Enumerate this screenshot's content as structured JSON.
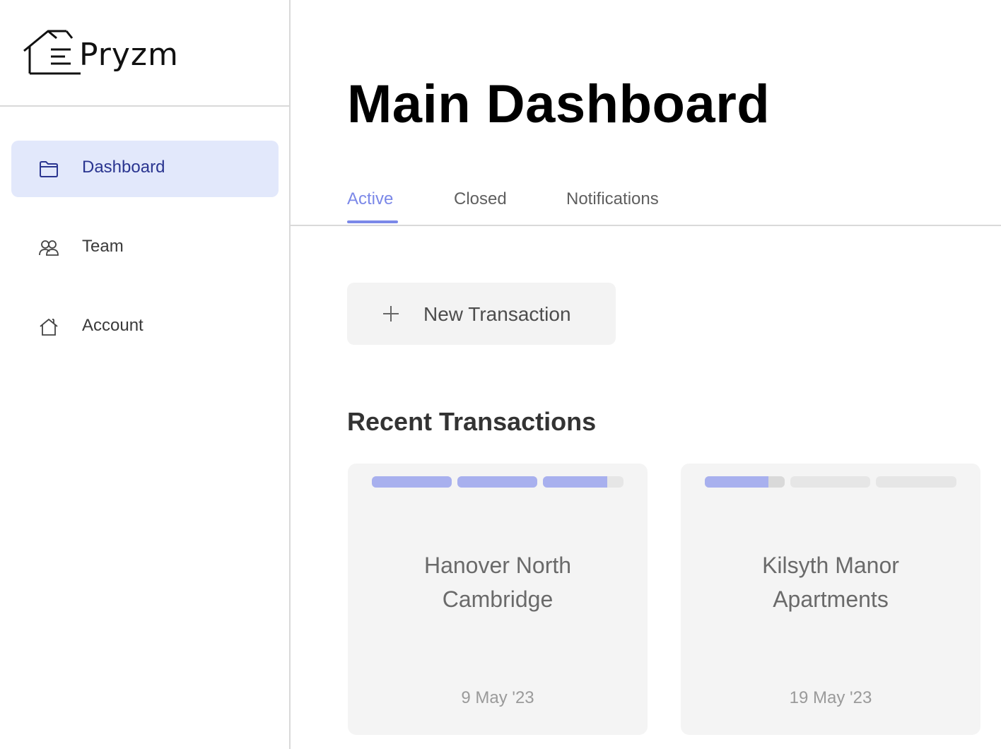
{
  "brand": {
    "name": "Pryzm"
  },
  "sidebar": {
    "items": [
      {
        "label": "Dashboard",
        "icon": "folder-icon",
        "active": true
      },
      {
        "label": "Team",
        "icon": "team-icon",
        "active": false
      },
      {
        "label": "Account",
        "icon": "home-icon",
        "active": false
      }
    ]
  },
  "main": {
    "title": "Main Dashboard",
    "tabs": [
      {
        "label": "Active",
        "active": true
      },
      {
        "label": "Closed",
        "active": false
      },
      {
        "label": "Notifications",
        "active": false
      }
    ],
    "new_button_label": "New Transaction",
    "section_title": "Recent Transactions",
    "cards": [
      {
        "title": "Hanover North Cambridge",
        "date": "9 May '23",
        "progress_segments": [
          1.0,
          1.0,
          0.8
        ]
      },
      {
        "title": "Kilsyth Manor Apartments",
        "date": "19 May '23",
        "progress_segments": [
          0.8,
          0,
          0
        ]
      }
    ]
  },
  "colors": {
    "accent": "#7b88e8",
    "progress_fill": "#a8b0ee",
    "active_nav_bg": "#e2e8fb",
    "active_nav_text": "#2a3590"
  }
}
